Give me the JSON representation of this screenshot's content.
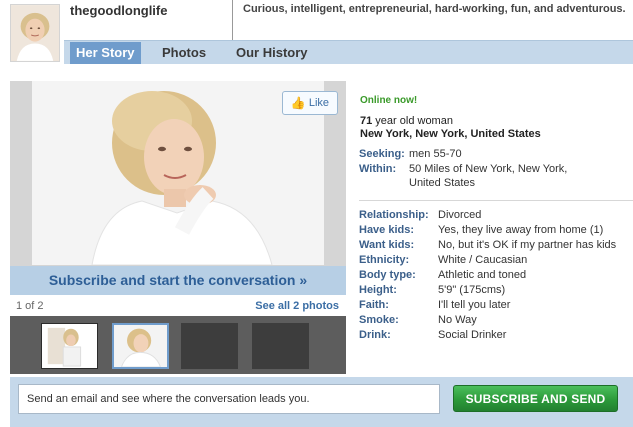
{
  "header": {
    "username": "thegoodlonglife",
    "tagline": "Curious, intelligent, entrepreneurial, hard-working, fun, and adventurous."
  },
  "tabs": [
    {
      "label": "Her Story",
      "active": true
    },
    {
      "label": "Photos",
      "active": false
    },
    {
      "label": "Our History",
      "active": false
    }
  ],
  "photo": {
    "like_label": "Like",
    "subscribe_text": "Subscribe and start the conversation »",
    "counter": "1 of 2",
    "see_all": "See all 2 photos"
  },
  "profile": {
    "status": "Online now!",
    "age_text": "71",
    "age_suffix": " year old woman",
    "location": "New York, New York, United States",
    "seeking": {
      "label": "Seeking:",
      "value": "men 55-70"
    },
    "within": {
      "label": "Within:",
      "value": "50 Miles of New York, New York, United States"
    },
    "details": [
      {
        "label": "Relationship:",
        "value": "Divorced"
      },
      {
        "label": "Have kids:",
        "value": "Yes, they live away from home (1)"
      },
      {
        "label": "Want kids:",
        "value": "No, but it's OK if my partner has kids"
      },
      {
        "label": "Ethnicity:",
        "value": "White / Caucasian"
      },
      {
        "label": "Body type:",
        "value": "Athletic and toned"
      },
      {
        "label": "Height:",
        "value": "5'9\" (175cms)"
      },
      {
        "label": "Faith:",
        "value": "I'll tell you later"
      },
      {
        "label": "Smoke:",
        "value": "No Way"
      },
      {
        "label": "Drink:",
        "value": "Social Drinker"
      }
    ]
  },
  "compose": {
    "placeholder": "Send an email and see where the conversation leads you.",
    "send_label": "SUBSCRIBE AND SEND"
  },
  "colors": {
    "tab_bar": "#c5d8ea",
    "active_tab": "#6f9ccc",
    "online_green": "#3a9a2a",
    "send_button": "#2c9a3a",
    "label_blue": "#3b5f8a"
  }
}
